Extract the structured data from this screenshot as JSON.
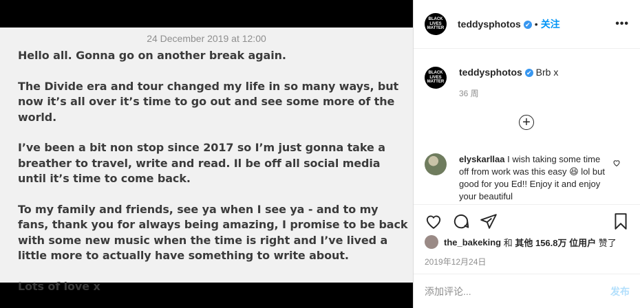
{
  "note": {
    "date": "24 December 2019 at 12:00",
    "paragraphs": [
      "Hello all. Gonna go on another break again.",
      "The Divide era and tour changed my life in so many ways, but now it’s all over it’s time to go out and see some more of the world.",
      "I’ve been a bit non stop since 2017 so I’m just gonna take a breather to travel, write and read. Il be off all social media until it’s time to come back.",
      "To my family and friends, see ya when I see ya - and to my fans, thank you for always being amazing, I promise to be back with some new music when the time is right and I’ve lived a little more to actually have something to write about.",
      "Lots of love x"
    ]
  },
  "header": {
    "avatar_text": "BLACK LIVES MATTER",
    "username": "teddysphotos",
    "verified_mark": "✔",
    "separator": "•",
    "follow_label": "关注",
    "more_label": "•••"
  },
  "caption": {
    "username": "teddysphotos",
    "text": "Brb x",
    "time_ago": "36 周"
  },
  "load_more": "+",
  "comment": {
    "username": "elyskarllaa",
    "text": "I wish taking some time off from work was this easy 😆 lol but good for you Ed!! Enjoy it and enjoy your beautiful"
  },
  "likes": {
    "user": "the_bakeking",
    "conj": "和",
    "others": "其他 156.8万 位用户",
    "suffix": "赞了"
  },
  "post_date": "2019年12月24日",
  "add_comment": {
    "placeholder": "添加评论...",
    "post_label": "发布"
  },
  "icons": {
    "like": "heart-icon",
    "comment": "comment-icon",
    "share": "paper-plane-icon",
    "save": "bookmark-icon"
  }
}
